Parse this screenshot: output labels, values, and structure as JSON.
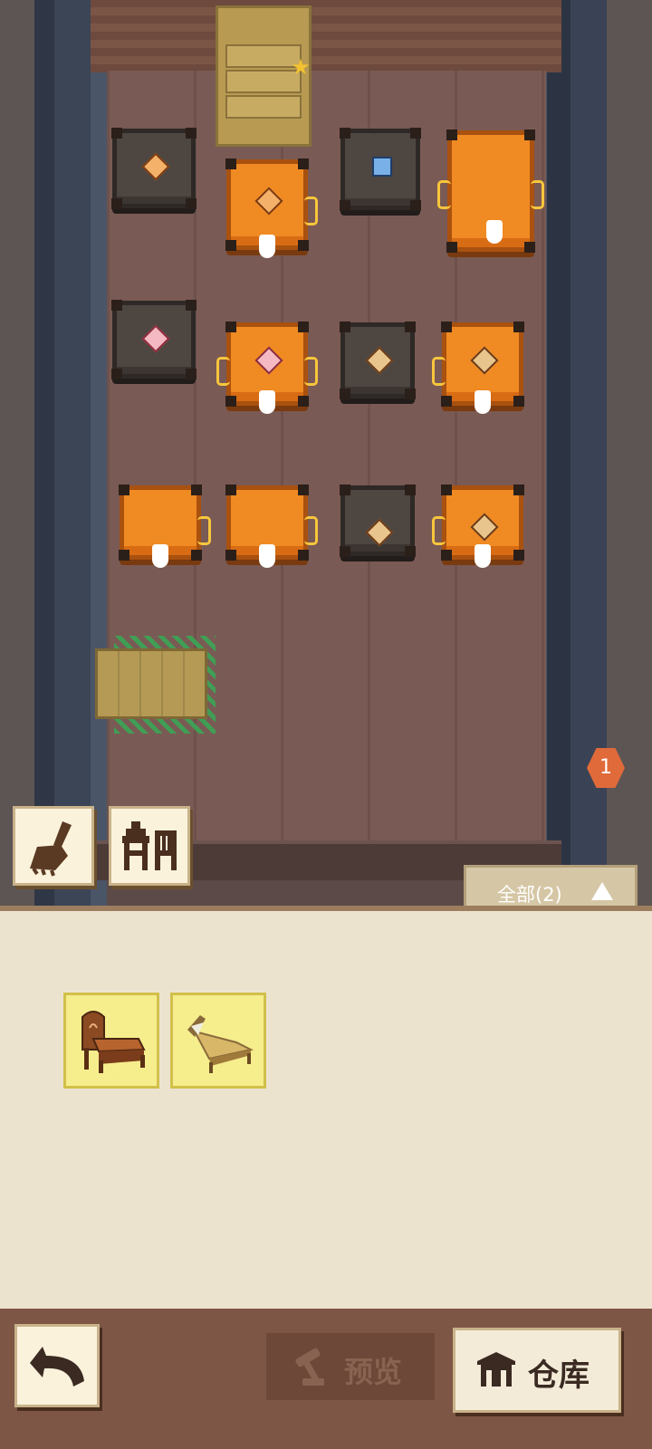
{
  "room": {
    "furniture": [
      {
        "name": "wardrobe",
        "icon": "wardrobe-icon"
      },
      {
        "name": "placed-bed",
        "icon": "bed-icon"
      }
    ],
    "crates": [
      {
        "color": "dark",
        "badge": "orange"
      },
      {
        "color": "orange",
        "badge": "orange"
      },
      {
        "color": "dark",
        "badge": "blue"
      },
      {
        "color": "orange",
        "badge": ""
      },
      {
        "color": "dark",
        "badge": "pink"
      },
      {
        "color": "orange",
        "badge": "pink"
      },
      {
        "color": "dark",
        "badge": "tan"
      },
      {
        "color": "orange",
        "badge": "tan"
      },
      {
        "color": "orange",
        "badge": ""
      },
      {
        "color": "orange",
        "badge": ""
      },
      {
        "color": "dark",
        "badge": "tan"
      },
      {
        "color": "orange",
        "badge": "tan"
      }
    ]
  },
  "notification": {
    "count": "1"
  },
  "tools": [
    {
      "icon": "broom-icon"
    },
    {
      "icon": "furniture-icon"
    }
  ],
  "filter": {
    "label": "全部(2)",
    "icon": "caret-up-icon"
  },
  "inventory": [
    {
      "icon": "wooden-bed-icon"
    },
    {
      "icon": "straw-bed-icon"
    }
  ],
  "bottom_bar": {
    "back_icon": "undo-arrow-icon",
    "preview_label": "预览",
    "warehouse_label": "仓库"
  },
  "colors": {
    "crate_orange": "#f08a22",
    "crate_dark": "#4e4641",
    "highlight_green": "#3aa655",
    "panel": "#ece3cf",
    "notification": "#e06a3a"
  }
}
